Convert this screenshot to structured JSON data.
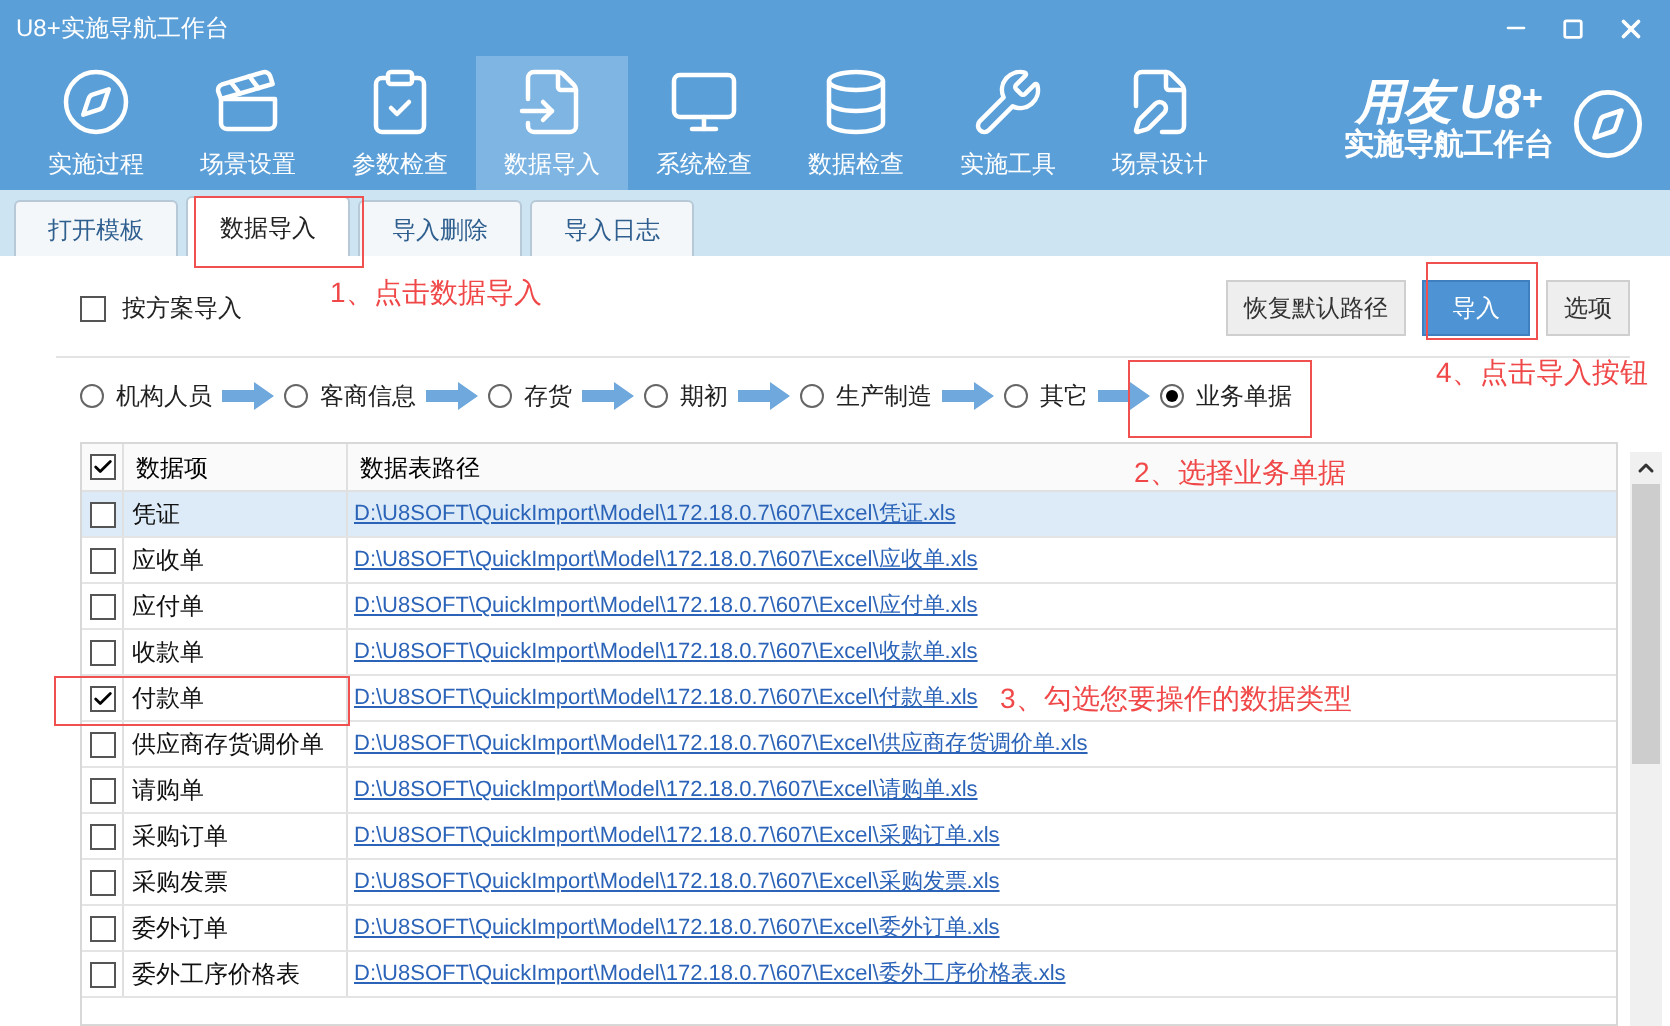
{
  "window": {
    "title": "U8+实施导航工作台"
  },
  "toolbar": [
    {
      "label": "实施过程",
      "selected": false
    },
    {
      "label": "场景设置",
      "selected": false
    },
    {
      "label": "参数检查",
      "selected": false
    },
    {
      "label": "数据导入",
      "selected": true
    },
    {
      "label": "系统检查",
      "selected": false
    },
    {
      "label": "数据检查",
      "selected": false
    },
    {
      "label": "实施工具",
      "selected": false
    },
    {
      "label": "场景设计",
      "selected": false
    }
  ],
  "logo": {
    "brand": "用友",
    "product": "U8",
    "plus": "+",
    "subtitle": "实施导航工作台"
  },
  "tabs": [
    {
      "label": "打开模板",
      "selected": false
    },
    {
      "label": "数据导入",
      "selected": true
    },
    {
      "label": "导入删除",
      "selected": false
    },
    {
      "label": "导入日志",
      "selected": false
    }
  ],
  "scheme_import": {
    "label": "按方案导入",
    "checked": false
  },
  "buttons": [
    {
      "label": "恢复默认路径",
      "kind": "secondary"
    },
    {
      "label": "导入",
      "kind": "primary"
    },
    {
      "label": "选项",
      "kind": "secondary"
    }
  ],
  "steps": [
    {
      "label": "机构人员",
      "selected": false
    },
    {
      "label": "客商信息",
      "selected": false
    },
    {
      "label": "存货",
      "selected": false
    },
    {
      "label": "期初",
      "selected": false
    },
    {
      "label": "生产制造",
      "selected": false
    },
    {
      "label": "其它",
      "selected": false
    },
    {
      "label": "业务单据",
      "selected": true
    }
  ],
  "table": {
    "header_checked": true,
    "columns": [
      "数据项",
      "数据表路径"
    ],
    "rows": [
      {
        "name": "凭证",
        "path": "D:\\U8SOFT\\QuickImport\\Model\\172.18.0.7\\607\\Excel\\凭证.xls",
        "checked": false,
        "selected": true
      },
      {
        "name": "应收单",
        "path": "D:\\U8SOFT\\QuickImport\\Model\\172.18.0.7\\607\\Excel\\应收单.xls",
        "checked": false,
        "selected": false
      },
      {
        "name": "应付单",
        "path": "D:\\U8SOFT\\QuickImport\\Model\\172.18.0.7\\607\\Excel\\应付单.xls",
        "checked": false,
        "selected": false
      },
      {
        "name": "收款单",
        "path": "D:\\U8SOFT\\QuickImport\\Model\\172.18.0.7\\607\\Excel\\收款单.xls",
        "checked": false,
        "selected": false
      },
      {
        "name": "付款单",
        "path": "D:\\U8SOFT\\QuickImport\\Model\\172.18.0.7\\607\\Excel\\付款单.xls",
        "checked": true,
        "selected": false
      },
      {
        "name": "供应商存货调价单",
        "path": "D:\\U8SOFT\\QuickImport\\Model\\172.18.0.7\\607\\Excel\\供应商存货调价单.xls",
        "checked": false,
        "selected": false
      },
      {
        "name": "请购单",
        "path": "D:\\U8SOFT\\QuickImport\\Model\\172.18.0.7\\607\\Excel\\请购单.xls",
        "checked": false,
        "selected": false
      },
      {
        "name": "采购订单",
        "path": "D:\\U8SOFT\\QuickImport\\Model\\172.18.0.7\\607\\Excel\\采购订单.xls",
        "checked": false,
        "selected": false
      },
      {
        "name": "采购发票",
        "path": "D:\\U8SOFT\\QuickImport\\Model\\172.18.0.7\\607\\Excel\\采购发票.xls",
        "checked": false,
        "selected": false
      },
      {
        "name": "委外订单",
        "path": "D:\\U8SOFT\\QuickImport\\Model\\172.18.0.7\\607\\Excel\\委外订单.xls",
        "checked": false,
        "selected": false
      },
      {
        "name": "委外工序价格表",
        "path": "D:\\U8SOFT\\QuickImport\\Model\\172.18.0.7\\607\\Excel\\委外工序价格表.xls",
        "checked": false,
        "selected": false
      }
    ]
  },
  "annotations": [
    {
      "text": "1、点击数据导入"
    },
    {
      "text": "2、选择业务单据"
    },
    {
      "text": "3、勾选您要操作的数据类型"
    },
    {
      "text": "4、点击导入按钮"
    }
  ]
}
